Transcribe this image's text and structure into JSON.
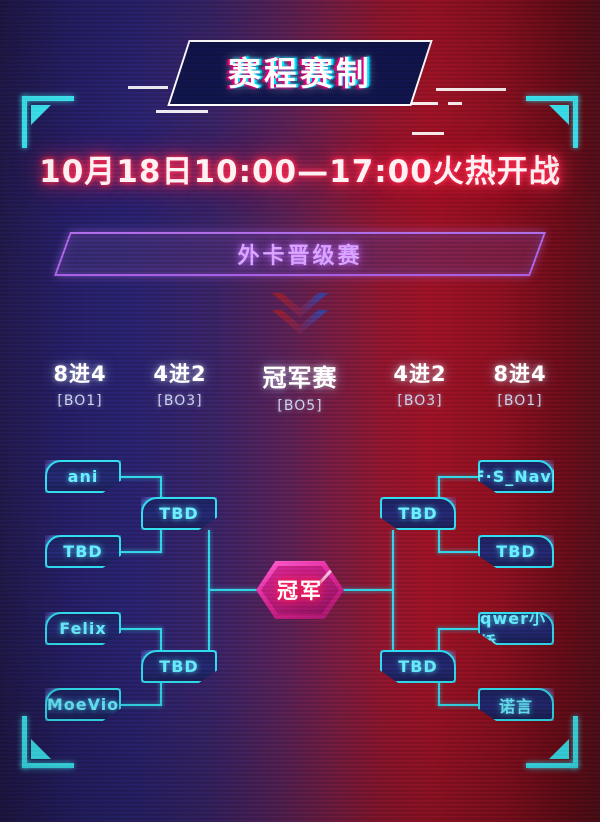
{
  "header": {
    "banner_title": "赛程赛制"
  },
  "main": {
    "date_title": "10月18日10:00—17:00火热开战",
    "subtitle_banner": "外卡晋级赛",
    "chevron_icon": "double-chevron-down-icon"
  },
  "rounds": [
    {
      "name": "8进4",
      "format": "[BO1]"
    },
    {
      "name": "4进2",
      "format": "[BO3]"
    },
    {
      "name": "冠军赛",
      "format": "[BO5]"
    },
    {
      "name": "4进2",
      "format": "[BO3]"
    },
    {
      "name": "8进4",
      "format": "[BO1]"
    }
  ],
  "bracket": {
    "champion_label": "冠军",
    "left": {
      "quarterfinals": [
        "ani",
        "TBD",
        "Felix",
        "MoeVio"
      ],
      "semifinals": [
        "TBD",
        "TBD"
      ]
    },
    "right": {
      "quarterfinals": [
        "F·S_Navi",
        "TBD",
        "qwer小桥",
        "诺言"
      ],
      "semifinals": [
        "TBD",
        "TBD"
      ]
    }
  },
  "colors": {
    "cyan": "#33dff0",
    "magenta": "#e431a8",
    "purple": "#b06ce8",
    "red_glow": "#ff2d55",
    "panel_blue": "#1e2463"
  }
}
